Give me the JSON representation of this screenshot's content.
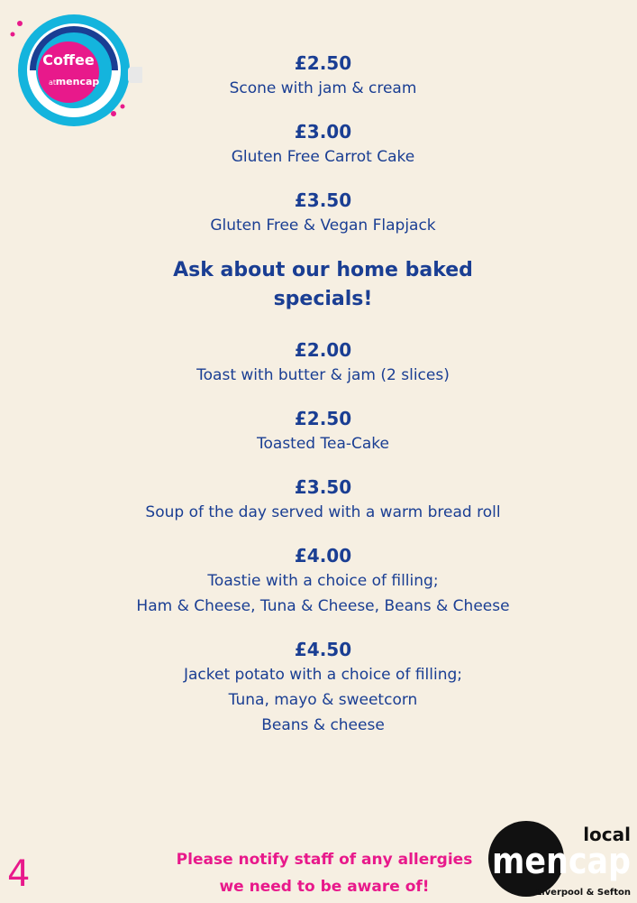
{
  "logos": {
    "coffee_word": "Coffee",
    "coffee_at": "at",
    "coffee_brand": "mencap",
    "local_word": "local",
    "local_brand": "mencap",
    "local_region": "Liverpool & Sefton"
  },
  "menu": {
    "items_top": [
      {
        "price": "£2.50",
        "desc": "Scone with jam & cream"
      },
      {
        "price": "£3.00",
        "desc": "Gluten Free Carrot Cake"
      },
      {
        "price": "£3.50",
        "desc": "Gluten Free & Vegan Flapjack"
      }
    ],
    "specials_line1": "Ask about our home baked",
    "specials_line2": "specials!",
    "items_bottom": [
      {
        "price": "£2.00",
        "desc": [
          "Toast with butter & jam (2 slices)"
        ]
      },
      {
        "price": "£2.50",
        "desc": [
          "Toasted Tea-Cake"
        ]
      },
      {
        "price": "£3.50",
        "desc": [
          "Soup of the day served with a warm bread roll"
        ]
      },
      {
        "price": "£4.00",
        "desc": [
          "Toastie with a choice of filling;",
          "Ham & Cheese, Tuna & Cheese, Beans & Cheese"
        ]
      },
      {
        "price": "£4.50",
        "desc": [
          "Jacket potato with a choice of filling;",
          "Tuna, mayo & sweetcorn",
          "Beans & cheese"
        ]
      }
    ]
  },
  "footer": {
    "allergy_line1": "Please notify staff of any allergies",
    "allergy_line2": "we need to be aware of!",
    "page_number": "4"
  },
  "colors": {
    "background": "#f6efe2",
    "navy": "#1a3e93",
    "pink": "#e8198b",
    "cyan": "#14b4dd"
  }
}
